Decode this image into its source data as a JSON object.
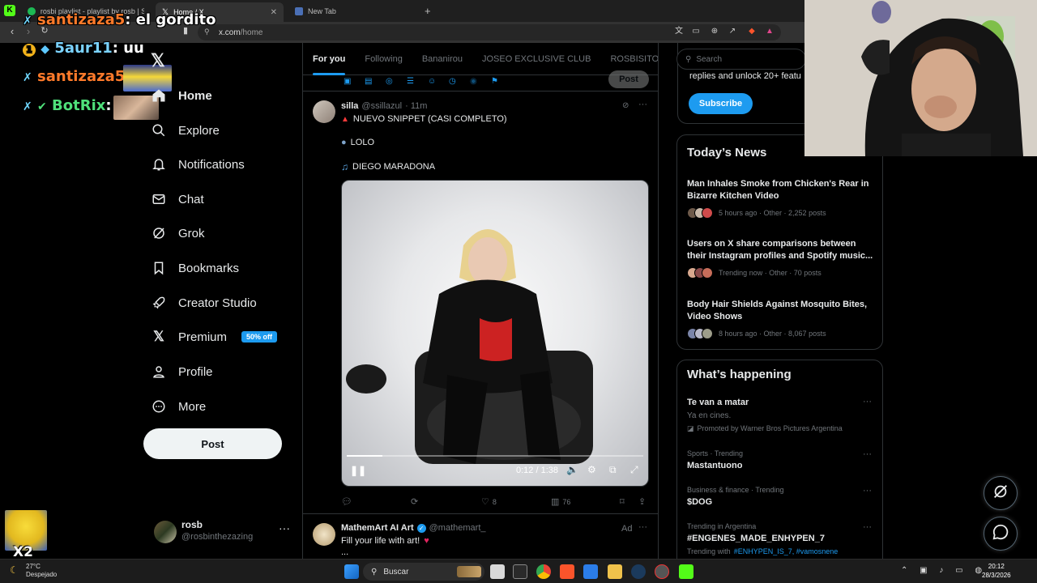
{
  "browser": {
    "tabs": [
      {
        "label": "rosbi playlist - playlist by rosb | Spoti"
      },
      {
        "label": "Home / X"
      },
      {
        "label": "New Tab"
      }
    ],
    "url_host": "x.com",
    "url_path": "/home"
  },
  "chat": [
    {
      "user": "santizaza5",
      "msg": ": el gordito"
    },
    {
      "user": "5aur11",
      "msg": ": uu"
    },
    {
      "user": "santizaza5",
      "msg": ":"
    },
    {
      "user": "BotRix",
      "msg": ":"
    }
  ],
  "chat_badge": "1",
  "multiplier": "X2",
  "nav": {
    "items": [
      {
        "label": "Home",
        "icon": "home-icon"
      },
      {
        "label": "Explore",
        "icon": "search-icon"
      },
      {
        "label": "Notifications",
        "icon": "bell-icon"
      },
      {
        "label": "Chat",
        "icon": "mail-icon"
      },
      {
        "label": "Grok",
        "icon": "grok-icon"
      },
      {
        "label": "Bookmarks",
        "icon": "bookmark-icon"
      },
      {
        "label": "Creator Studio",
        "icon": "rocket-icon"
      },
      {
        "label": "Premium",
        "icon": "x-logo-icon"
      },
      {
        "label": "Profile",
        "icon": "person-icon"
      },
      {
        "label": "More",
        "icon": "more-circle-icon"
      }
    ],
    "premium_badge": "50% off",
    "post_label": "Post"
  },
  "account": {
    "name": "rosb",
    "handle": "@rosbinthezazing"
  },
  "feed": {
    "tabs": [
      "For you",
      "Following",
      "Bananirou",
      "JOSEO EXCLUSIVE CLUB",
      "ROSBISITOS"
    ],
    "composer_post": "Post",
    "post1": {
      "name": "silla",
      "handle": "@ssillazul",
      "time": "· 11m",
      "line1": "NUEVO SNIPPET (CASI COMPLETO)",
      "line2": "LOLO",
      "line3": "DIEGO MARADONA",
      "video_time": "0:12 / 1:38",
      "progress": 0.12,
      "likes": "8",
      "views": "76"
    },
    "post2": {
      "name": "MathemArt AI Art",
      "handle": "@mathemart_",
      "ad": "Ad",
      "text": "Fill your life with art!",
      "ellipsis": "..."
    }
  },
  "right": {
    "search_placeholder": "Search",
    "premium_text": "replies and unlock 20+ featu",
    "subscribe": "Subscribe",
    "news_title": "Today’s News",
    "news": [
      {
        "headline": "Man Inhales Smoke from Chicken's Rear in Bizarre Kitchen Video",
        "meta": "5 hours ago · Other · 2,252 posts"
      },
      {
        "headline": "Users on X share comparisons between their Instagram profiles and Spotify music...",
        "meta": "Trending now · Other · 70 posts"
      },
      {
        "headline": "Body Hair Shields Against Mosquito Bites, Video Shows",
        "meta": "8 hours ago · Other · 8,067 posts"
      }
    ],
    "happening_title": "What’s happening",
    "trends": [
      {
        "category": "",
        "name": "Te van a matar",
        "sub": "Ya en cines.",
        "promo": "Promoted by Warner Bros Pictures Argentina"
      },
      {
        "category": "Sports · Trending",
        "name": "Mastantuono"
      },
      {
        "category": "Business & finance · Trending",
        "name": "$DOG"
      },
      {
        "category": "Trending in Argentina",
        "name": "#ENGENES_MADE_ENHYPEN_7",
        "with_label": "Trending with",
        "with_links": "#ENHYPEN_IS_7, #vamosnene"
      }
    ]
  },
  "taskbar": {
    "temp": "27°C",
    "weather": "Despejado",
    "search": "Buscar",
    "time": "20:12",
    "date": "28/3/2026"
  }
}
